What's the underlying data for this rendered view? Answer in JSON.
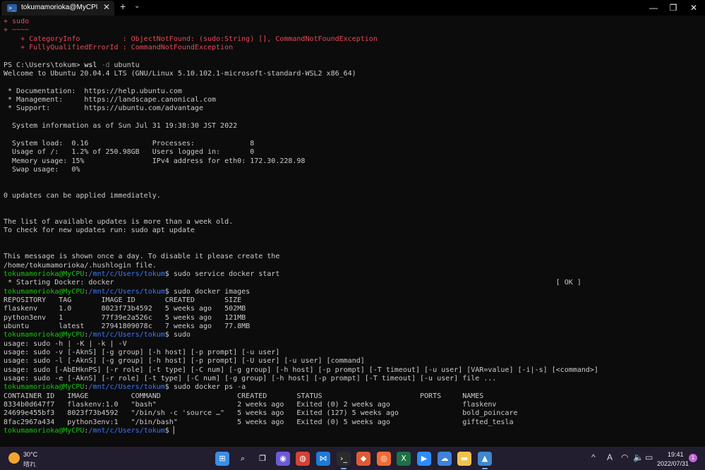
{
  "titlebar": {
    "tab_title": "tokumamorioka@MyCPU: /mnt/c/Users/tokum",
    "tab_icon": "terminal-icon",
    "close_glyph": "✕",
    "new_tab_glyph": "+",
    "dropdown_glyph": "⌄",
    "minimize_glyph": "—",
    "maximize_glyph": "❐",
    "window_close_glyph": "✕"
  },
  "terminal": {
    "colors": {
      "text": "#cccccc",
      "error": "#e74856",
      "prompt_user": "#16c60c",
      "prompt_path": "#3b78ff",
      "command_bright": "#f2f2f2",
      "ps_flag": "#767676"
    },
    "lines": [
      [
        {
          "t": "+ sudo",
          "c": "error"
        }
      ],
      [
        {
          "t": "+ ~~~~",
          "c": "error"
        }
      ],
      [
        {
          "t": "    + CategoryInfo          : ObjectNotFound: (sudo:String) [], CommandNotFoundException",
          "c": "error"
        }
      ],
      [
        {
          "t": "    + FullyQualifiedErrorId : CommandNotFoundException",
          "c": "error"
        }
      ],
      [],
      [
        {
          "t": "PS C:\\Users\\tokum> ",
          "c": "text"
        },
        {
          "t": "wsl",
          "c": "command_bright"
        },
        {
          "t": " -d",
          "c": "ps_flag"
        },
        {
          "t": " ubuntu",
          "c": "text"
        }
      ],
      [
        {
          "t": "Welcome to Ubuntu 20.04.4 LTS (GNU/Linux 5.10.102.1-microsoft-standard-WSL2 x86_64)",
          "c": "text"
        }
      ],
      [],
      [
        {
          "t": " * Documentation:  https://help.ubuntu.com",
          "c": "text"
        }
      ],
      [
        {
          "t": " * Management:     https://landscape.canonical.com",
          "c": "text"
        }
      ],
      [
        {
          "t": " * Support:        https://ubuntu.com/advantage",
          "c": "text"
        }
      ],
      [],
      [
        {
          "t": "  System information as of Sun Jul 31 19:38:30 JST 2022",
          "c": "text"
        }
      ],
      [],
      [
        {
          "t": "  System load:  0.16               Processes:             8",
          "c": "text"
        }
      ],
      [
        {
          "t": "  Usage of /:   1.2% of 250.98GB   Users logged in:       0",
          "c": "text"
        }
      ],
      [
        {
          "t": "  Memory usage: 15%                IPv4 address for eth0: 172.30.228.98",
          "c": "text"
        }
      ],
      [
        {
          "t": "  Swap usage:   0%",
          "c": "text"
        }
      ],
      [],
      [],
      [
        {
          "t": "0 updates can be applied immediately.",
          "c": "text"
        }
      ],
      [],
      [],
      [
        {
          "t": "The list of available updates is more than a week old.",
          "c": "text"
        }
      ],
      [
        {
          "t": "To check for new updates run: sudo apt update",
          "c": "text"
        }
      ],
      [],
      [],
      [
        {
          "t": "This message is shown once a day. To disable it please create the",
          "c": "text"
        }
      ],
      [
        {
          "t": "/home/tokumamorioka/.hushlogin file.",
          "c": "text"
        }
      ],
      [
        {
          "t": "tokumamorioka@MyCPU",
          "c": "prompt_user"
        },
        {
          "t": ":",
          "c": "text"
        },
        {
          "t": "/mnt/c/Users/tokum",
          "c": "prompt_path"
        },
        {
          "t": "$ sudo service docker start",
          "c": "text"
        }
      ],
      [
        {
          "t": " * Starting Docker: docker                                                                                                        [ OK ]",
          "c": "text"
        }
      ],
      [
        {
          "t": "tokumamorioka@MyCPU",
          "c": "prompt_user"
        },
        {
          "t": ":",
          "c": "text"
        },
        {
          "t": "/mnt/c/Users/tokum",
          "c": "prompt_path"
        },
        {
          "t": "$ sudo docker images",
          "c": "text"
        }
      ],
      [
        {
          "t": "REPOSITORY   TAG       IMAGE ID       CREATED       SIZE",
          "c": "text"
        }
      ],
      [
        {
          "t": "flaskenv     1.0       8023f73b4592   5 weeks ago   502MB",
          "c": "text"
        }
      ],
      [
        {
          "t": "python3env   1         77f39e2a526c   5 weeks ago   121MB",
          "c": "text"
        }
      ],
      [
        {
          "t": "ubuntu       latest    27941809078c   7 weeks ago   77.8MB",
          "c": "text"
        }
      ],
      [
        {
          "t": "tokumamorioka@MyCPU",
          "c": "prompt_user"
        },
        {
          "t": ":",
          "c": "text"
        },
        {
          "t": "/mnt/c/Users/tokum",
          "c": "prompt_path"
        },
        {
          "t": "$ sudo",
          "c": "text"
        }
      ],
      [
        {
          "t": "usage: sudo -h | -K | -k | -V",
          "c": "text"
        }
      ],
      [
        {
          "t": "usage: sudo -v [-AknS] [-g group] [-h host] [-p prompt] [-u user]",
          "c": "text"
        }
      ],
      [
        {
          "t": "usage: sudo -l [-AknS] [-g group] [-h host] [-p prompt] [-U user] [-u user] [command]",
          "c": "text"
        }
      ],
      [
        {
          "t": "usage: sudo [-AbEHknPS] [-r role] [-t type] [-C num] [-g group] [-h host] [-p prompt] [-T timeout] [-u user] [VAR=value] [-i|-s] [<command>]",
          "c": "text"
        }
      ],
      [
        {
          "t": "usage: sudo -e [-AknS] [-r role] [-t type] [-C num] [-g group] [-h host] [-p prompt] [-T timeout] [-u user] file ...",
          "c": "text"
        }
      ],
      [
        {
          "t": "tokumamorioka@MyCPU",
          "c": "prompt_user"
        },
        {
          "t": ":",
          "c": "text"
        },
        {
          "t": "/mnt/c/Users/tokum",
          "c": "prompt_path"
        },
        {
          "t": "$ sudo docker ps -a",
          "c": "text"
        }
      ],
      [
        {
          "t": "CONTAINER ID   IMAGE          COMMAND                  CREATED       STATUS                       PORTS     NAMES",
          "c": "text"
        }
      ],
      [
        {
          "t": "8334b0d647f7   flaskenv:1.0   \"bash\"                   2 weeks ago   Exited (0) 2 weeks ago                 flaskenv",
          "c": "text"
        }
      ],
      [
        {
          "t": "24699e455bf3   8023f73b4592   \"/bin/sh -c 'source …\"   5 weeks ago   Exited (127) 5 weeks ago               bold_poincare",
          "c": "text"
        }
      ],
      [
        {
          "t": "8fac2967a434   python3env:1   \"/bin/bash\"              5 weeks ago   Exited (0) 5 weeks ago                 gifted_tesla",
          "c": "text"
        }
      ],
      [
        {
          "t": "tokumamorioka@MyCPU",
          "c": "prompt_user"
        },
        {
          "t": ":",
          "c": "text"
        },
        {
          "t": "/mnt/c/Users/tokum",
          "c": "prompt_path"
        },
        {
          "t": "$ ",
          "c": "text"
        },
        {
          "t": "▏",
          "c": "command_bright"
        }
      ]
    ]
  },
  "taskbar": {
    "weather_temp": "30°C",
    "weather_condition": "晴れ",
    "apps": [
      {
        "name": "start-icon",
        "glyph": "⊞",
        "color": "#3a8ee6",
        "active": false
      },
      {
        "name": "search-icon",
        "glyph": "⌕",
        "color": "transparent",
        "active": false
      },
      {
        "name": "task-view-icon",
        "glyph": "❐",
        "color": "transparent",
        "active": false
      },
      {
        "name": "chat-icon",
        "glyph": "◉",
        "color": "#6b5bd6",
        "active": false
      },
      {
        "name": "chrome-icon",
        "glyph": "◍",
        "color": "#d44236",
        "active": false
      },
      {
        "name": "vscode-icon",
        "glyph": "⋈",
        "color": "#1f7ad6",
        "active": false
      },
      {
        "name": "terminal-app-icon",
        "glyph": "›_",
        "color": "#2b2b2b",
        "active": true
      },
      {
        "name": "git-icon",
        "glyph": "◆",
        "color": "#e15a32",
        "active": false
      },
      {
        "name": "postman-icon",
        "glyph": "◎",
        "color": "#ef6c34",
        "active": false
      },
      {
        "name": "excel-icon",
        "glyph": "X",
        "color": "#1e7145",
        "active": false
      },
      {
        "name": "zoom-icon",
        "glyph": "▶",
        "color": "#2d8cff",
        "active": false
      },
      {
        "name": "cloud-app-icon",
        "glyph": "☁",
        "color": "#3f83d8",
        "active": false
      },
      {
        "name": "file-explorer-icon",
        "glyph": "▬",
        "color": "#f2c14e",
        "active": false
      },
      {
        "name": "photos-icon",
        "glyph": "▲",
        "color": "#3e88cf",
        "active": true
      }
    ],
    "tray": {
      "chevron": "^",
      "ime": "A",
      "wifi": "◠",
      "volume": "🔈",
      "battery": "▭"
    },
    "time": "19:41",
    "date": "2022/07/31",
    "notification_count": "1"
  }
}
